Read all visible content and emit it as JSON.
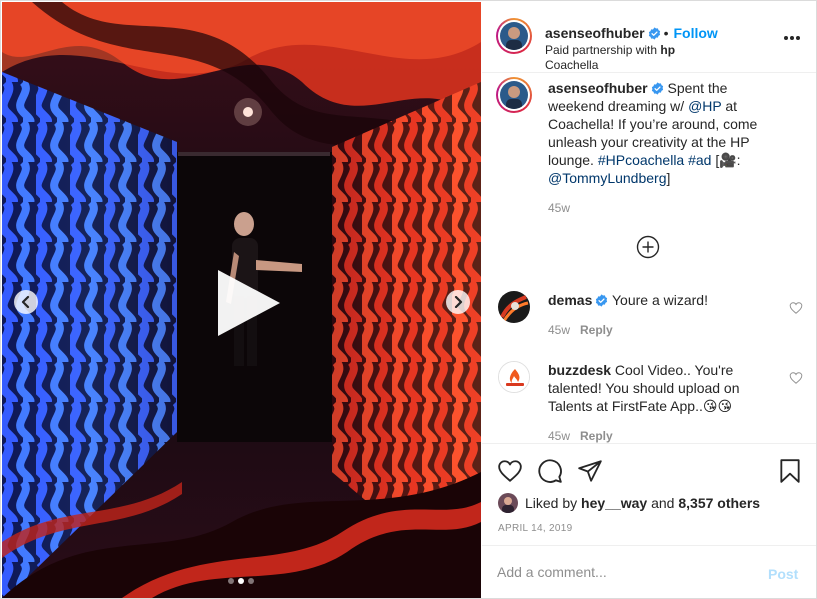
{
  "post": {
    "username": "asenseofhuber",
    "verified": true,
    "follow_label": "Follow",
    "separator": "•",
    "partnership_prefix": "Paid partnership with",
    "partner": "hp",
    "location": "Coachella"
  },
  "caption": {
    "username": "asenseofhuber",
    "text_1": "Spent the weekend dreaming w/",
    "mention_hp": "@HP",
    "text_2": "at Coachella! If you’re around, come unleash your creativity at the HP lounge.",
    "hashtag_1": "#HPcoachella",
    "hashtag_2": "#ad",
    "text_3": "[🎥:",
    "mention_2": "@TommyLundberg",
    "text_4": "]",
    "time": "45w"
  },
  "comments": [
    {
      "username": "demas",
      "verified": true,
      "text": "Youre a wizard!",
      "time": "45w",
      "reply_label": "Reply"
    },
    {
      "username": "buzzdesk",
      "verified": false,
      "text": "Cool Video.. You're talented! You should upload on Talents at FirstFate App..😘😘",
      "time": "45w",
      "reply_label": "Reply"
    }
  ],
  "icons": {
    "verified": "verified-badge-icon",
    "more": "more-options-icon",
    "play": "play-icon",
    "prev": "chevron-left-icon",
    "next": "chevron-right-icon",
    "load_more": "plus-circle-icon",
    "like": "heart-icon",
    "comment": "comment-icon",
    "share": "paper-plane-icon",
    "save": "bookmark-icon"
  },
  "likes": {
    "prefix": "Liked by",
    "user": "hey__way",
    "conj": "and",
    "count": "8,357 others"
  },
  "date": "APRIL 14, 2019",
  "add_comment": {
    "placeholder": "Add a comment...",
    "post_label": "Post"
  },
  "carousel": {
    "slides": 3,
    "active": 2
  },
  "colors": {
    "accent": "#0095f6",
    "link": "#00376b",
    "muted": "#8e8e8e",
    "post_disabled": "#b2dffc"
  }
}
